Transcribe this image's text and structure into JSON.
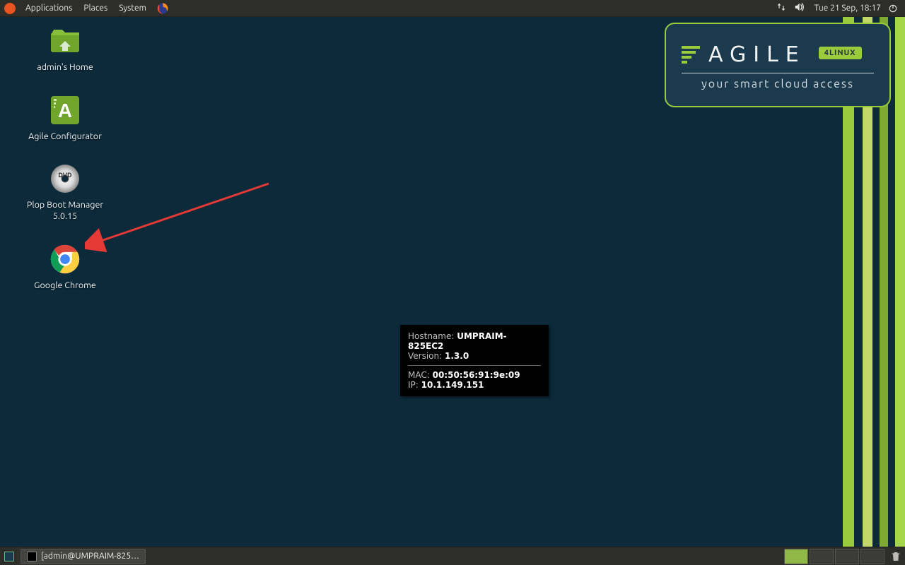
{
  "top_panel": {
    "menu": {
      "applications": "Applications",
      "places": "Places",
      "system": "System"
    },
    "clock": "Tue 21 Sep, 18:17"
  },
  "brand": {
    "title": "AGILE",
    "badge": "4LINUX",
    "subtitle": "your smart cloud access"
  },
  "desktop_icons": {
    "home": "admin's Home",
    "configurator": "Agile Configurator",
    "plop_line1": "Plop Boot Manager",
    "plop_line2": "5.0.15",
    "chrome": "Google Chrome"
  },
  "sysinfo": {
    "hostname_key": "Hostname:",
    "hostname_val": "UMPRAIM-825EC2",
    "version_key": "Version:",
    "version_val": "1.3.0",
    "mac_key": "MAC:",
    "mac_val": "00:50:56:91:9e:09",
    "ip_key": "IP:",
    "ip_val": "10.1.149.151"
  },
  "taskbar": {
    "window_title": "[admin@UMPRAIM-825…"
  }
}
